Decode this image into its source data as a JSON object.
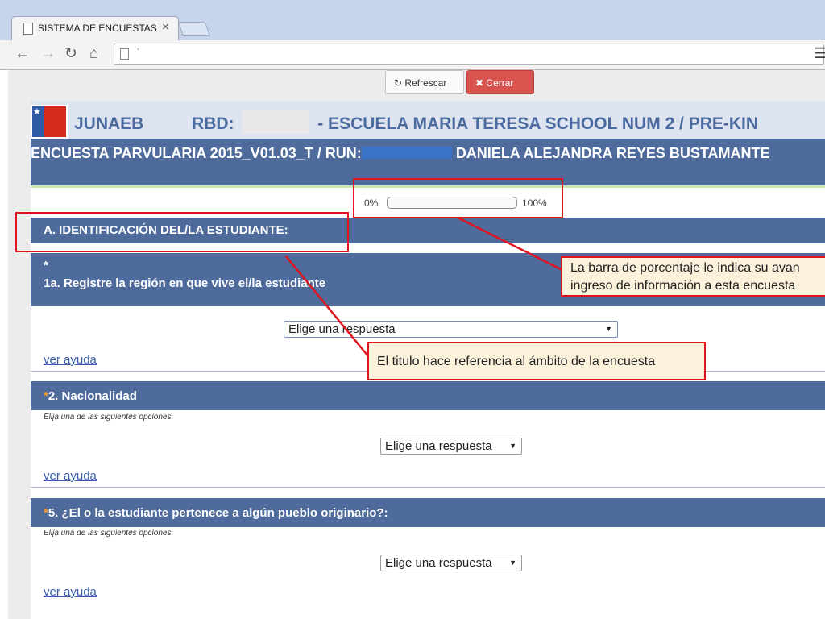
{
  "browser": {
    "tab_title": "SISTEMA DE ENCUESTAS -",
    "tab_close": "×",
    "url": "˙",
    "nav": {
      "back": "←",
      "forward": "→",
      "reload": "↻",
      "home": "⌂"
    }
  },
  "actions": {
    "refresh_label": "Refrescar",
    "refresh_icon": "↻",
    "close_label": "Cerrar",
    "close_icon": "✖"
  },
  "header": {
    "org": "JUNAEB",
    "rbd_label": "RBD:",
    "school": "- ESCUELA MARIA TERESA SCHOOL NUM 2 / PRE-KIN",
    "survey_prefix": "ENCUESTA PARVULARIA 2015_V01.03_T / RUN:",
    "student_name": "DANIELA ALEJANDRA REYES BUSTAMANTE"
  },
  "progress": {
    "min_label": "0%",
    "max_label": "100%",
    "value": 0
  },
  "section": {
    "title": "A. IDENTIFICACIÓN DEL/LA ESTUDIANTE:"
  },
  "questions": [
    {
      "asterisk": "*",
      "text": "1a. Registre la región en que vive el/la estudiante",
      "hint": "",
      "select_value": "Elige una respuesta",
      "help": "ver ayuda"
    },
    {
      "asterisk": "*",
      "text": "2. Nacionalidad",
      "hint": "Elija una de las siguientes opciones.",
      "select_value": "Elige una respuesta",
      "help": "ver ayuda"
    },
    {
      "asterisk": "*",
      "text": "5. ¿El o la estudiante pertenece a algún pueblo originario?:",
      "hint": "Elija una de las siguientes opciones.",
      "select_value": "Elige una respuesta",
      "help": "ver ayuda"
    }
  ],
  "annotations": {
    "progress_note_1": "La barra de porcentaje le indica su avan",
    "progress_note_2": "ingreso de información a esta encuesta",
    "title_note": "El titulo hace referencia al ámbito de la encuesta"
  },
  "colors": {
    "header_blue": "#4e6b9c",
    "callout_red": "#e0141e",
    "close_button": "#d9534f",
    "asterisk": "#f49b2c"
  }
}
